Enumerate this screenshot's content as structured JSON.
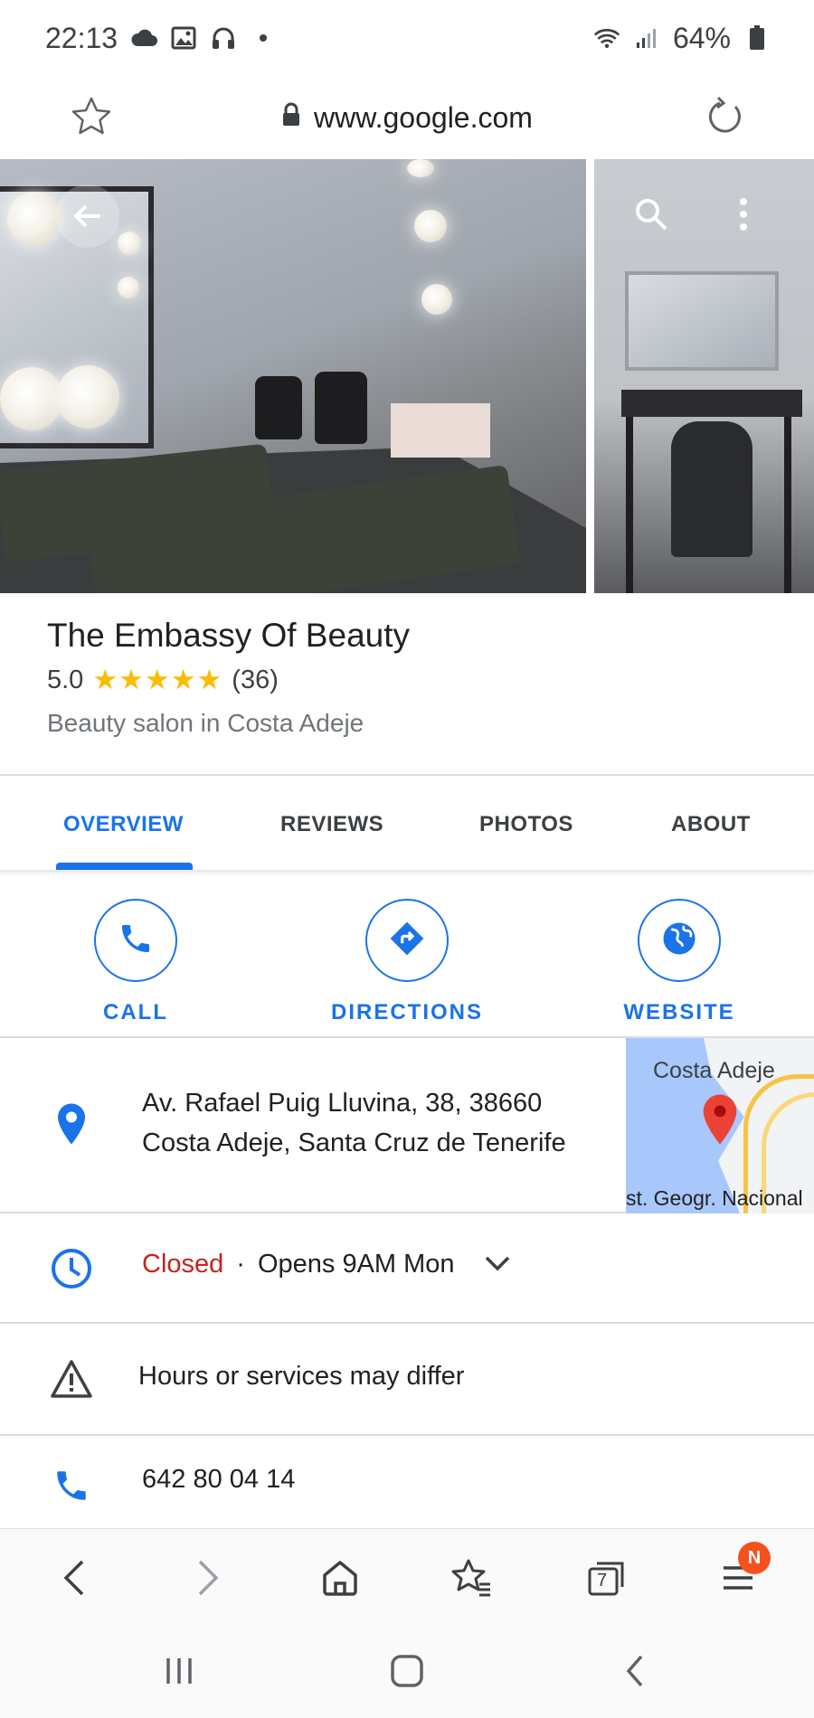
{
  "status_bar": {
    "time": "22:13",
    "battery": "64%",
    "icons": [
      "cloud-icon",
      "image-icon",
      "headphones-icon",
      "dot-icon",
      "wifi-icon",
      "signal-icon",
      "battery-icon"
    ]
  },
  "url_bar": {
    "url": "www.google.com",
    "icons": [
      "star-outline-icon",
      "lock-icon",
      "reload-icon"
    ]
  },
  "photos": {
    "icons": [
      "back-arrow-icon",
      "search-icon",
      "more-vert-icon"
    ]
  },
  "place": {
    "title": "The Embassy Of Beauty",
    "rating": "5.0",
    "stars": "★★★★★",
    "star_count": 5,
    "reviews_count": "(36)",
    "category": "Beauty salon in Costa Adeje"
  },
  "tabs": [
    {
      "label": "OVERVIEW",
      "active": true
    },
    {
      "label": "REVIEWS",
      "active": false
    },
    {
      "label": "PHOTOS",
      "active": false
    },
    {
      "label": "ABOUT",
      "active": false
    }
  ],
  "actions": [
    {
      "label": "CALL",
      "icon": "phone-icon"
    },
    {
      "label": "DIRECTIONS",
      "icon": "directions-icon"
    },
    {
      "label": "WEBSITE",
      "icon": "globe-icon"
    }
  ],
  "address": {
    "line1": "Av. Rafael Puig Lluvina, 38, 38660",
    "line2": "Costa Adeje, Santa Cruz de Tenerife",
    "map_label_top": "Costa Adeje",
    "map_label_bottom": "st. Geogr. Nacional"
  },
  "hours": {
    "status": "Closed",
    "separator": "·",
    "next": "Opens 9AM Mon"
  },
  "notice": {
    "text": "Hours or services may differ"
  },
  "phone": {
    "number": "642 80 04 14"
  },
  "browser_bar": {
    "tabs_count": "7",
    "badge": "N",
    "icons": [
      "back-icon",
      "forward-icon",
      "home-icon",
      "bookmarks-icon",
      "tabs-icon",
      "menu-icon"
    ]
  },
  "nav_bar": {
    "icons": [
      "recents-icon",
      "home-nav-icon",
      "back-nav-icon"
    ]
  },
  "colors": {
    "accent": "#1a73e8",
    "star": "#fbbc04",
    "closed": "#c5221f",
    "badge": "#f4511e"
  }
}
